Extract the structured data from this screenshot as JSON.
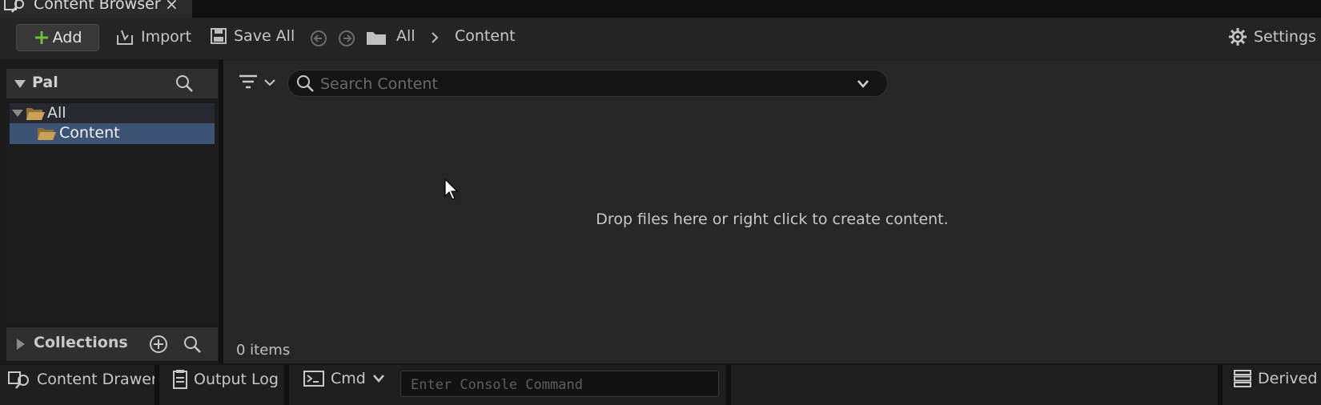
{
  "tab": {
    "title": "Content Browser",
    "close": "×",
    "icon": "content-browser-icon"
  },
  "toolbar": {
    "add_label": "Add",
    "import_label": "Import",
    "save_all_label": "Save All",
    "breadcrumb": [
      "All",
      "Content"
    ],
    "settings_label": "Settings"
  },
  "sources": {
    "header": "Pal",
    "tree": [
      {
        "label": "All",
        "expanded": true,
        "icon": "folder-open-icon"
      },
      {
        "label": "Content",
        "selected": true,
        "icon": "folder-open-icon"
      }
    ],
    "collections_label": "Collections"
  },
  "main": {
    "search_placeholder": "Search Content",
    "empty_message": "Drop files here or right click to create content.",
    "item_count": "0 items"
  },
  "statusbar": {
    "content_drawer_label": "Content Drawer",
    "output_log_label": "Output Log",
    "cmd_label": "Cmd",
    "console_placeholder": "Enter Console Command",
    "derived_label": "Derived D"
  },
  "colors": {
    "accent_add": "#6fbf3a",
    "folder": "#c9a15a",
    "selection": "#3d5373"
  }
}
